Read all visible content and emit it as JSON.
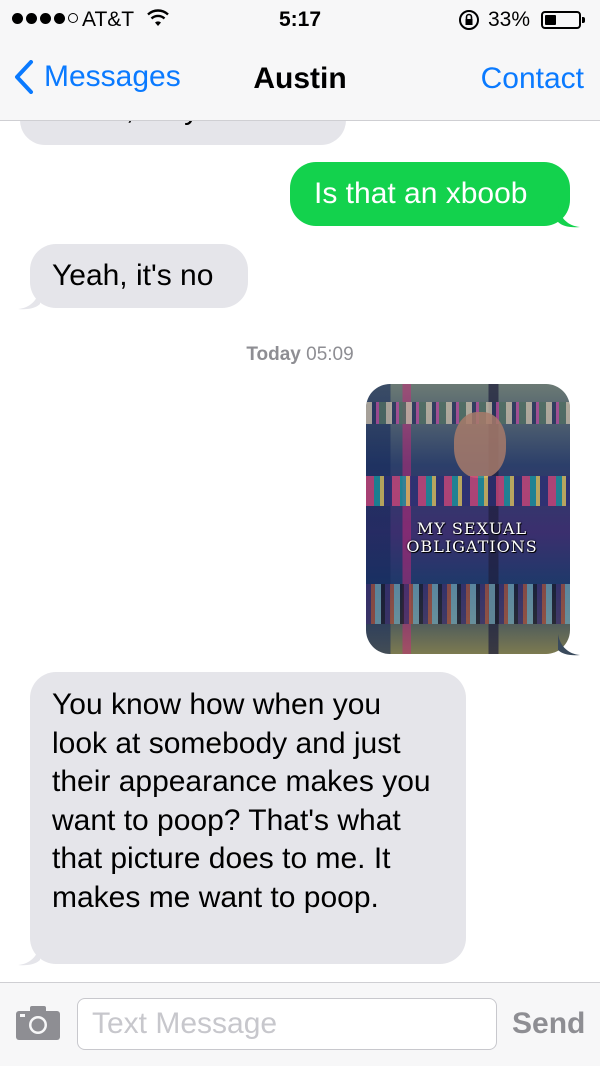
{
  "status_bar": {
    "carrier": "AT&T",
    "time": "5:17",
    "battery_percent": "33%",
    "signal_bars": 4,
    "battery_level": 0.33
  },
  "nav": {
    "back_label": "Messages",
    "title": "Austin",
    "action_label": "Contact"
  },
  "conversation": {
    "partial_message": "Dude, do you like?",
    "messages": [
      {
        "side": "outgoing",
        "text": "Is that an xboob"
      },
      {
        "side": "incoming",
        "text": "Yeah, it's no"
      }
    ],
    "timestamp_day": "Today",
    "timestamp_time": "05:09",
    "image_caption_line1": "MY SEXUAL",
    "image_caption_line2": "OBLIGATIONS",
    "last_message": "You know how when you look at somebody and just their appearance makes you want to poop? That's what that picture does to me. It makes me want to poop."
  },
  "composer": {
    "placeholder": "Text Message",
    "value": "",
    "send_label": "Send"
  },
  "colors": {
    "accent": "#0a7aff",
    "outgoing_bubble": "#13d24d",
    "incoming_bubble": "#e5e5ea"
  },
  "icons": [
    "wifi-icon",
    "lock-rotation-icon",
    "battery-icon",
    "back-chevron-icon",
    "camera-icon"
  ]
}
